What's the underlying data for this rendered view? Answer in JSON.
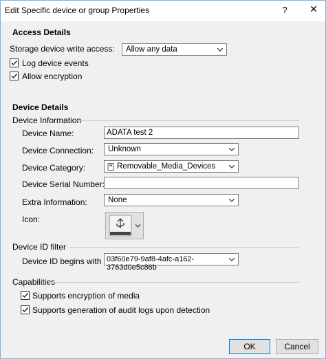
{
  "window": {
    "title": "Edit Specific device or group Properties",
    "help_label": "?",
    "close_label": "✕"
  },
  "access": {
    "heading": "Access Details",
    "write_access_label": "Storage device write access:",
    "write_access_value": "Allow any data",
    "log_events_label": "Log device events",
    "allow_encryption_label": "Allow encryption"
  },
  "device": {
    "heading": "Device Details",
    "info_group": "Device Information",
    "name_label": "Device Name:",
    "name_value": "ADATA test 2",
    "connection_label": "Device Connection:",
    "connection_value": "Unknown",
    "category_label": "Device Category:",
    "category_value": "Removable_Media_Devices",
    "serial_label": "Device Serial Number:",
    "serial_value": "",
    "extra_label": "Extra Information:",
    "extra_value": "None",
    "icon_label": "Icon:"
  },
  "filter": {
    "group": "Device ID filter",
    "begins_label": "Device ID begins with",
    "begins_value": "03f60e79-9af8-4afc-a162-3763d0e5c86b"
  },
  "capabilities": {
    "group": "Capabilities",
    "encryption_label": "Supports encryption of media",
    "audit_label": "Supports generation of audit logs upon detection"
  },
  "buttons": {
    "ok": "OK",
    "cancel": "Cancel"
  }
}
